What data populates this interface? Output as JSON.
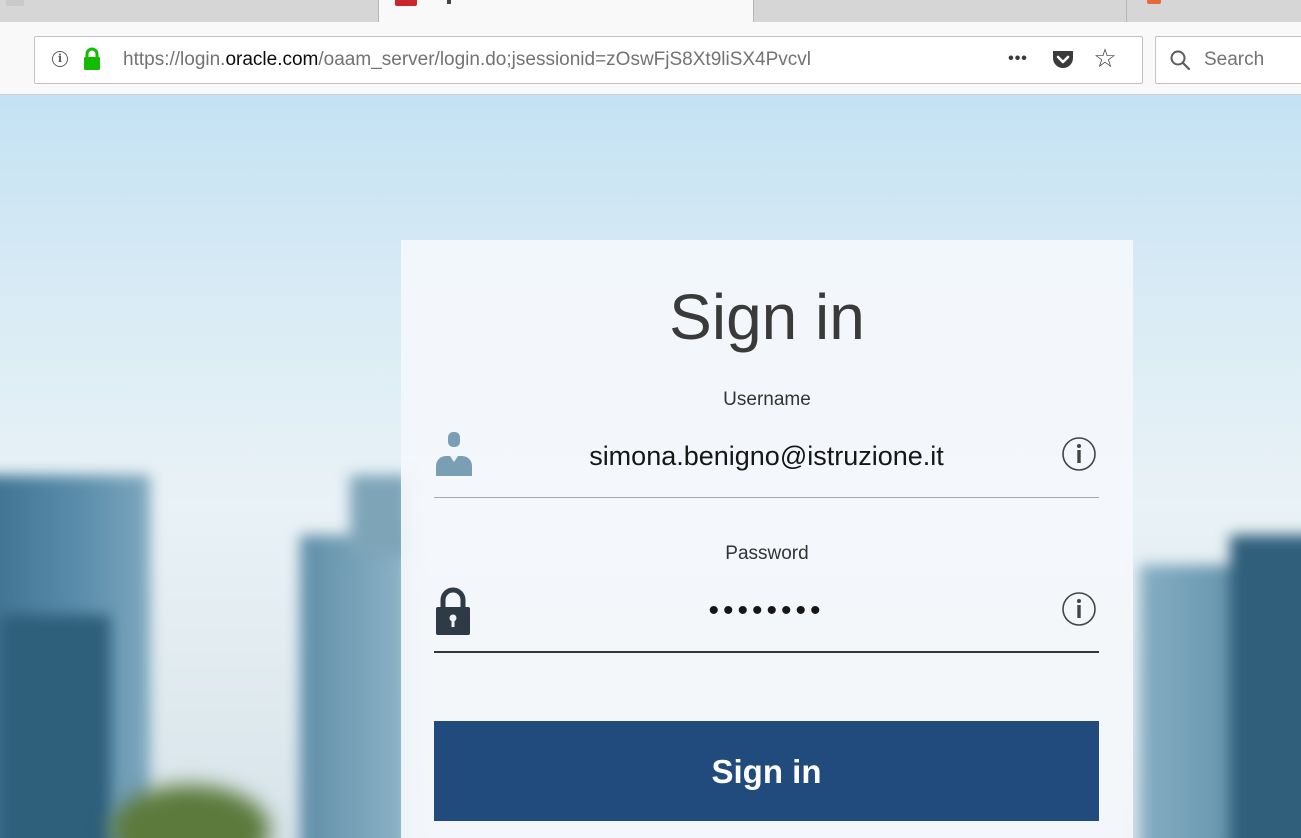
{
  "browser": {
    "url": {
      "scheme": "https://",
      "host_prefix": "login.",
      "host": "oracle.com",
      "path": "/oaam_server/login.do;jsessionid=zOswFjS8Xt9liSX4Pvcvl"
    },
    "more_icon": "more-horizontal-icon",
    "search_placeholder": "Search"
  },
  "login": {
    "title": "Sign in",
    "username_label": "Username",
    "username_value": "simona.benigno@istruzione.it",
    "password_label": "Password",
    "password_value": "••••••••",
    "submit_label": "Sign in",
    "icons": {
      "user": "user-icon",
      "lock": "lock-icon",
      "help": "info-circle-icon"
    }
  },
  "colors": {
    "button": "#214b7d",
    "secure_lock": "#12bc00",
    "user_icon": "#7a9fb4",
    "lock_icon": "#2e3b47"
  }
}
